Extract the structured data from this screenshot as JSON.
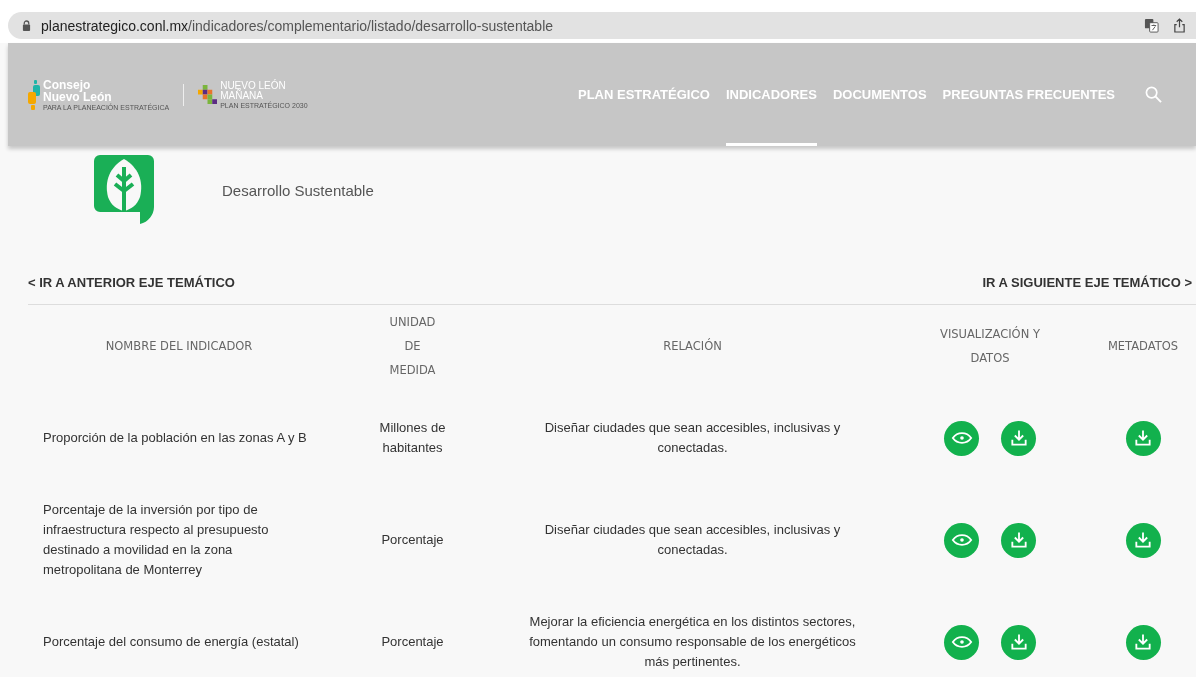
{
  "browser": {
    "url_domain": "planestrategico.conl.mx",
    "url_path": "/indicadores/complementario/listado/desarrollo-sustentable"
  },
  "header": {
    "logo_primary": {
      "line1": "Consejo",
      "line2": "Nuevo León",
      "tagline": "PARA LA PLANEACIÓN ESTRATÉGICA"
    },
    "logo_secondary": {
      "line1": "NUEVO LEÓN",
      "line2": "MAÑANA",
      "tagline": "PLAN ESTRATÉGICO 2030"
    },
    "nav": [
      {
        "label": "PLAN ESTRATÉGICO",
        "selected": false
      },
      {
        "label": "INDICADORES",
        "selected": true
      },
      {
        "label": "DOCUMENTOS",
        "selected": false
      },
      {
        "label": "PREGUNTAS FRECUENTES",
        "selected": false
      }
    ]
  },
  "theme": {
    "title": "Desarrollo Sustentable"
  },
  "pager": {
    "previous": "< IR A ANTERIOR EJE TEMÁTICO",
    "next": "IR A SIGUIENTE EJE TEMÁTICO >"
  },
  "table": {
    "columns": [
      "NOMBRE DEL INDICADOR",
      "UNIDAD DE MEDIDA",
      "RELACIÓN",
      "VISUALIZACIÓN Y DATOS",
      "METADATOS"
    ],
    "rows": [
      {
        "name": "Proporción de la población en las zonas A y B",
        "unit": "Millones de habitantes",
        "relation": "Diseñar ciudades que sean accesibles, inclusivas y conectadas."
      },
      {
        "name": "Porcentaje de la inversión por tipo de infraestructura respecto al presupuesto destinado a movilidad en la zona metropolitana de Monterrey",
        "unit": "Porcentaje",
        "relation": "Diseñar ciudades que sean accesibles, inclusivas y conectadas."
      },
      {
        "name": "Porcentaje del consumo de energía (estatal)",
        "unit": "Porcentaje",
        "relation": "Mejorar la eficiencia energética en los distintos sectores, fomentando un consumo responsable de los energéticos más pertinentes."
      }
    ]
  }
}
